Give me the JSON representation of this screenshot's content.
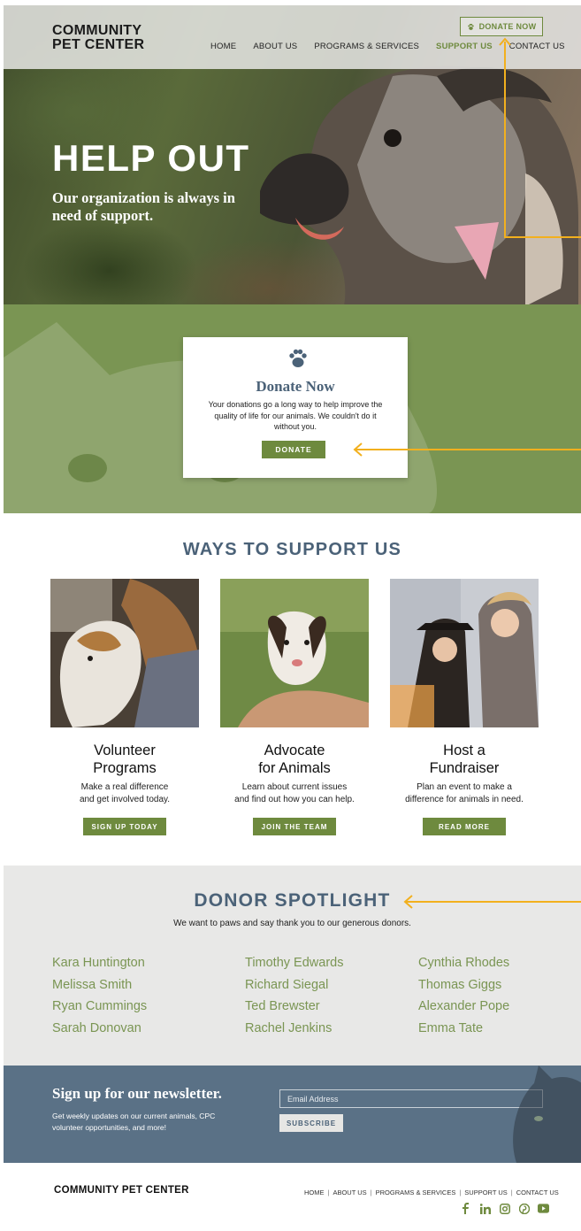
{
  "header": {
    "logo_line1": "COMMUNITY",
    "logo_line2": "PET CENTER",
    "donate_button": "DONATE NOW",
    "nav": [
      "HOME",
      "ABOUT US",
      "PROGRAMS & SERVICES",
      "SUPPORT US",
      "CONTACT US"
    ],
    "active_nav": "SUPPORT US"
  },
  "hero": {
    "title": "HELP OUT",
    "subtitle": "Our organization is always in need of support."
  },
  "donate_card": {
    "icon": "paw-icon",
    "title": "Donate Now",
    "text": "Your donations go a long way to help improve the quality of life for our animals. We couldn't do it without you.",
    "button": "DONATE"
  },
  "ways": {
    "title": "WAYS TO SUPPORT US",
    "cards": [
      {
        "title": "Volunteer\nPrograms",
        "text": "Make a real difference\nand get involved today.",
        "button": "SIGN UP TODAY"
      },
      {
        "title": "Advocate\nfor Animals",
        "text": "Learn about current issues\nand find out how you can help.",
        "button": "JOIN THE TEAM"
      },
      {
        "title": "Host a\nFundraiser",
        "text": "Plan an event to make a\ndifference for animals in need.",
        "button": "READ MORE"
      }
    ]
  },
  "spotlight": {
    "title": "DONOR SPOTLIGHT",
    "subtitle": "We want to paws and say thank you to our generous donors.",
    "columns": [
      [
        "Kara Huntington",
        "Melissa Smith",
        "Ryan Cummings",
        "Sarah Donovan"
      ],
      [
        "Timothy Edwards",
        "Richard Siegal",
        "Ted Brewster",
        "Rachel Jenkins"
      ],
      [
        "Cynthia Rhodes",
        "Thomas Giggs",
        "Alexander Pope",
        "Emma Tate"
      ]
    ]
  },
  "newsletter": {
    "title": "Sign up for our newsletter.",
    "text": "Get weekly updates on our current animals, CPC volunteer opportunities, and more!",
    "placeholder": "Email Address",
    "button": "SUBSCRIBE"
  },
  "footer": {
    "logo": "COMMUNITY PET CENTER",
    "nav": [
      "HOME",
      "ABOUT US",
      "PROGRAMS & SERVICES",
      "SUPPORT US",
      "CONTACT US"
    ],
    "social": [
      "facebook-icon",
      "linkedin-icon",
      "instagram-icon",
      "pinterest-icon",
      "youtube-icon"
    ]
  },
  "colors": {
    "green": "#6e8a3e",
    "slate": "#4b6278",
    "annotation": "#f2b01e",
    "spotlight_bg": "#e8e8e7",
    "newsletter_bg": "#5a7186"
  }
}
